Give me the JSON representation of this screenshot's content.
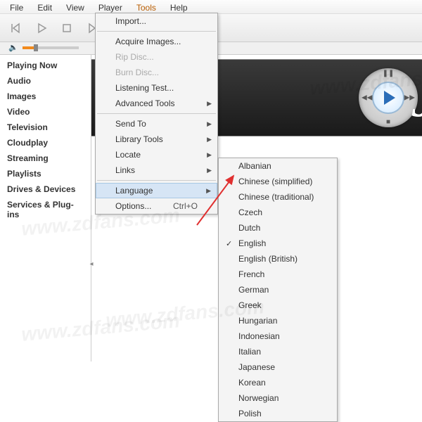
{
  "menubar": {
    "items": [
      "File",
      "Edit",
      "View",
      "Player",
      "Tools",
      "Help"
    ],
    "active_index": 4
  },
  "sidebar": {
    "items": [
      "Playing Now",
      "Audio",
      "Images",
      "Video",
      "Television",
      "Cloudplay",
      "Streaming",
      "Playlists",
      "Drives & Devices",
      "Services & Plug-ins"
    ]
  },
  "tools_menu": {
    "groups": [
      [
        {
          "label": "Import...",
          "enabled": true
        }
      ],
      [
        {
          "label": "Acquire Images...",
          "enabled": true
        },
        {
          "label": "Rip Disc...",
          "enabled": false
        },
        {
          "label": "Burn Disc...",
          "enabled": false
        },
        {
          "label": "Listening Test...",
          "enabled": true
        },
        {
          "label": "Advanced Tools",
          "enabled": true,
          "submenu": true
        }
      ],
      [
        {
          "label": "Send To",
          "enabled": true,
          "submenu": true
        },
        {
          "label": "Library Tools",
          "enabled": true,
          "submenu": true
        },
        {
          "label": "Locate",
          "enabled": true,
          "submenu": true
        },
        {
          "label": "Links",
          "enabled": true,
          "submenu": true
        }
      ],
      [
        {
          "label": "Language",
          "enabled": true,
          "submenu": true,
          "highlight": true
        },
        {
          "label": "Options...",
          "enabled": true,
          "shortcut": "Ctrl+O"
        }
      ]
    ]
  },
  "lang_menu": {
    "items": [
      {
        "label": "Albanian"
      },
      {
        "label": "Chinese (simplified)"
      },
      {
        "label": "Chinese (traditional)"
      },
      {
        "label": "Czech"
      },
      {
        "label": "Dutch"
      },
      {
        "label": "English",
        "checked": true
      },
      {
        "label": "English (British)"
      },
      {
        "label": "French"
      },
      {
        "label": "German"
      },
      {
        "label": "Greek"
      },
      {
        "label": "Hungarian"
      },
      {
        "label": "Indonesian"
      },
      {
        "label": "Italian"
      },
      {
        "label": "Japanese"
      },
      {
        "label": "Korean"
      },
      {
        "label": "Norwegian"
      },
      {
        "label": "Polish"
      }
    ]
  },
  "watermark": "www.zdfans.com",
  "banner_letter": "J"
}
